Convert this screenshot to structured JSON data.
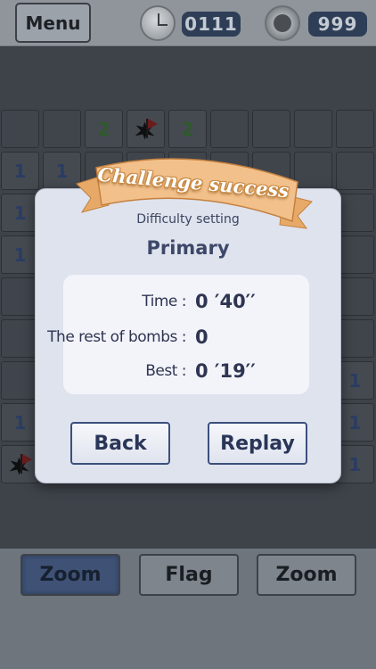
{
  "topbar": {
    "menu_label": "Menu",
    "timer": "0111",
    "bombs": "999"
  },
  "board": {
    "cells": [
      {
        "col": 2,
        "row": 0,
        "text": "2",
        "color": "green"
      },
      {
        "col": 3,
        "row": 0,
        "flag": true
      },
      {
        "col": 4,
        "row": 0,
        "text": "2",
        "color": "green"
      },
      {
        "col": 0,
        "row": 1,
        "text": "1"
      },
      {
        "col": 1,
        "row": 1,
        "text": "1"
      },
      {
        "col": 0,
        "row": 2,
        "text": "1"
      },
      {
        "col": 0,
        "row": 3,
        "text": "1"
      },
      {
        "col": 8,
        "row": 6,
        "text": "1"
      },
      {
        "col": 0,
        "row": 7,
        "text": "1"
      },
      {
        "col": 8,
        "row": 7,
        "text": "1"
      },
      {
        "col": 0,
        "row": 8,
        "flag": true
      },
      {
        "col": 8,
        "row": 8,
        "text": "1"
      }
    ]
  },
  "dialog": {
    "banner": "Challenge success",
    "subtitle": "Difficulty setting",
    "level": "Primary",
    "stats": {
      "time_label": "Time :",
      "time_value": "0 ′40′′",
      "bombs_label": "The rest of bombs :",
      "bombs_value": "0",
      "best_label": "Best :",
      "best_value": "0 ′19′′"
    },
    "back_label": "Back",
    "replay_label": "Replay"
  },
  "bottom": {
    "zoom_left": "Zoom",
    "flag": "Flag",
    "zoom_right": "Zoom"
  }
}
